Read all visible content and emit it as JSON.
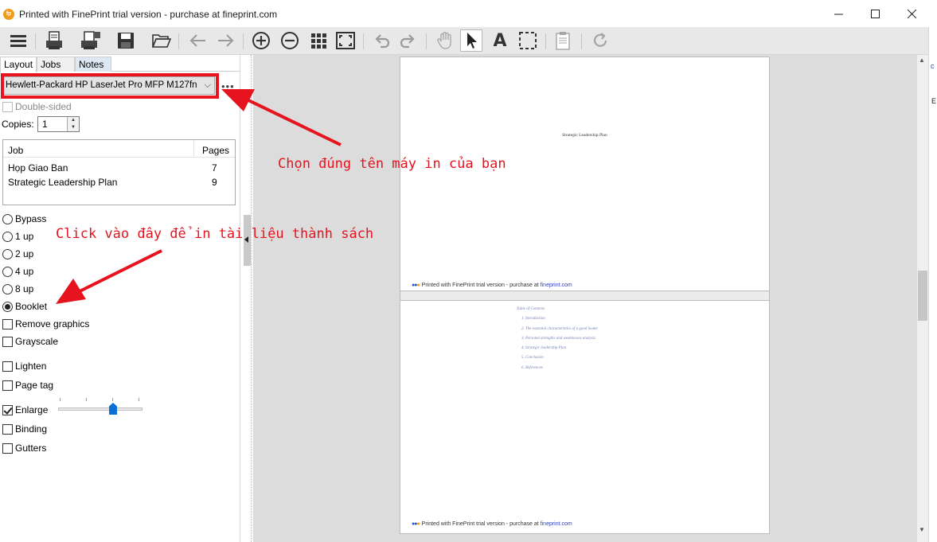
{
  "window": {
    "title": "Printed with FinePrint trial version - purchase at fineprint.com",
    "app_icon": "fp",
    "controls": {
      "minimize": "—",
      "maximize": "☐",
      "close": "✕"
    }
  },
  "toolbar": {
    "icons": [
      "menu-icon",
      "print-icon",
      "print-setup-icon",
      "save-icon",
      "open-folder-icon",
      "back-arrow-icon",
      "forward-arrow-icon",
      "zoom-in-icon",
      "zoom-out-icon",
      "grid-view-icon",
      "fit-page-icon",
      "undo-icon",
      "redo-icon",
      "hand-tool-icon",
      "select-pointer-icon",
      "text-tool-icon",
      "marquee-select-icon",
      "edit-page-icon",
      "refresh-icon"
    ],
    "text_tool_label": "A"
  },
  "tabs": [
    {
      "label": "Layout",
      "active": true
    },
    {
      "label": "Jobs",
      "active": false
    },
    {
      "label": "Notes",
      "active": false
    }
  ],
  "printer": {
    "selected": "Hewlett-Packard HP LaserJet Pro MFP M127fn",
    "chevron": "⌵",
    "more": "•••"
  },
  "options": {
    "double_sided": "Double-sided",
    "copies_label": "Copies:",
    "copies_value": "1"
  },
  "job_table": {
    "headers": {
      "job": "Job",
      "pages": "Pages"
    },
    "rows": [
      {
        "job": "Họp Giao Ban",
        "pages": "7"
      },
      {
        "job": "Strategic Leadership Plan",
        "pages": "9"
      }
    ]
  },
  "layout_modes": [
    {
      "label": "Bypass",
      "selected": false
    },
    {
      "label": "1 up",
      "selected": false
    },
    {
      "label": "2 up",
      "selected": false
    },
    {
      "label": "4 up",
      "selected": false
    },
    {
      "label": "8 up",
      "selected": false
    },
    {
      "label": "Booklet",
      "selected": true
    }
  ],
  "checkboxes": {
    "remove_graphics": {
      "label": "Remove graphics",
      "checked": false
    },
    "grayscale": {
      "label": "Grayscale",
      "checked": false
    },
    "lighten": {
      "label": "Lighten",
      "checked": false
    },
    "page_tag": {
      "label": "Page tag",
      "checked": false
    },
    "enlarge": {
      "label": "Enlarge",
      "checked": true,
      "slider_level": 0.65
    },
    "binding": {
      "label": "Binding",
      "checked": false
    },
    "gutters": {
      "label": "Gutters",
      "checked": false
    }
  },
  "preview": {
    "page1_title": "Strategic Leadership Plan",
    "footer_prefix": "Printed with FinePrint trial version - purchase at ",
    "footer_link": "fineprint.com",
    "toc": {
      "heading": "Table of Contents",
      "items": [
        "1.  Introduction",
        "2.  The essential characteristics of a good leader",
        "3.  Personal strengths and weaknesses analysis",
        "4.  Strategic leadership Plan",
        "5.  Conclusion",
        "6.  References"
      ]
    }
  },
  "annotations": {
    "printer_hint": "Chọn đúng tên máy in của bạn",
    "booklet_hint": "Click vào đây để in tài liệu thành sách",
    "color": "#e5141f"
  },
  "background_window_chars": [
    "c",
    "E"
  ]
}
